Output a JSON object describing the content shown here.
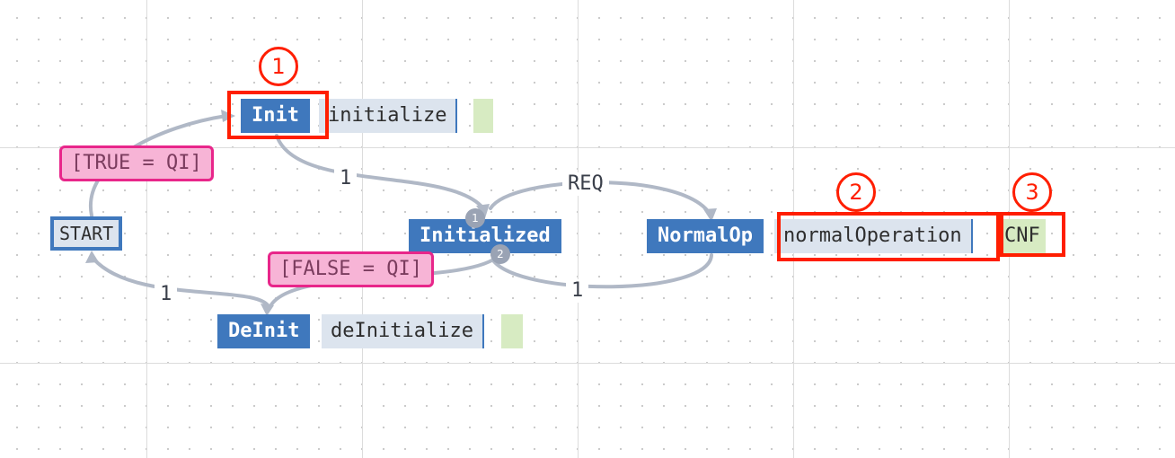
{
  "colors": {
    "state": "#3f78bd",
    "algorithm": "#dce4ee",
    "output": "#d7ebc2",
    "condition_fill": "#f7b4d6",
    "condition_border": "#e8268a",
    "edge": "#b0b8c6",
    "highlight": "#ff1e00"
  },
  "states": {
    "start": "START",
    "init": "Init",
    "initialized": "Initialized",
    "normal_op": "NormalOp",
    "deinit": "DeInit"
  },
  "algorithms": {
    "init": "initialize",
    "normal_op": "normalOperation",
    "deinit": "deInitialize"
  },
  "outputs": {
    "normal_op": "CNF"
  },
  "conditions": {
    "true_qi": "[TRUE = QI]",
    "false_qi": "[FALSE = QI]"
  },
  "edge_labels": {
    "init_to_initialized": "1",
    "initialized_to_normal": "REQ",
    "normal_to_initialized": "1",
    "deinit_to_start": "1"
  },
  "priority_badges": [
    "1",
    "2"
  ],
  "callouts": [
    "1",
    "2",
    "3"
  ]
}
